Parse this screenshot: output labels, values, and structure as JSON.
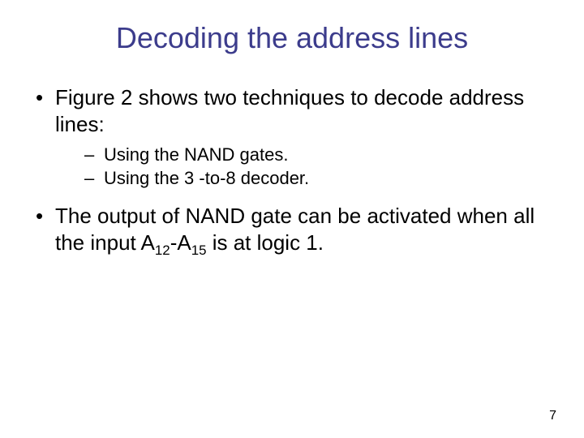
{
  "title": "Decoding the address lines",
  "bullets": [
    {
      "text": "Figure 2 shows two techniques to decode address lines:",
      "subs": [
        "Using the NAND gates.",
        "Using the 3 -to-8 decoder."
      ]
    },
    {
      "text_before_sub1": "The output of NAND gate can be activated when all the input A",
      "sub1": "12",
      "mid": "-A",
      "sub2": "15",
      "text_after": " is at logic 1."
    }
  ],
  "page_number": "7"
}
